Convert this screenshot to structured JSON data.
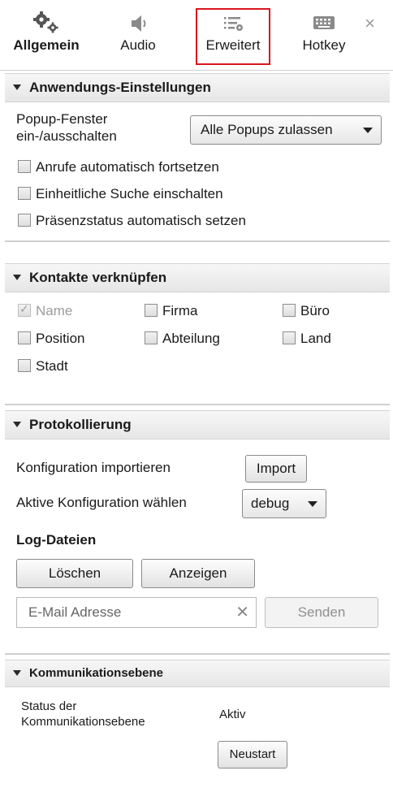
{
  "tabs": [
    {
      "label": "Allgemein",
      "icon": "gears-icon"
    },
    {
      "label": "Audio",
      "icon": "speaker-icon"
    },
    {
      "label": "Erweitert",
      "icon": "advanced-settings-icon"
    },
    {
      "label": "Hotkey",
      "icon": "keyboard-icon"
    }
  ],
  "close_glyph": "×",
  "app_settings": {
    "title": "Anwendungs-Einstellungen",
    "popup_label_line1": "Popup-Fenster",
    "popup_label_line2": "ein-/ausschalten",
    "popup_value": "Alle Popups zulassen",
    "checkboxes": [
      {
        "label": "Anrufe automatisch fortsetzen",
        "checked": false
      },
      {
        "label": "Einheitliche Suche einschalten",
        "checked": false
      },
      {
        "label": "Präsenzstatus automatisch setzen",
        "checked": false
      }
    ]
  },
  "contacts": {
    "title": "Kontakte verknüpfen",
    "fields": [
      {
        "label": "Name",
        "checked": true,
        "disabled": true
      },
      {
        "label": "Firma",
        "checked": false
      },
      {
        "label": "Büro",
        "checked": false
      },
      {
        "label": "Position",
        "checked": false
      },
      {
        "label": "Abteilung",
        "checked": false
      },
      {
        "label": "Land",
        "checked": false
      },
      {
        "label": "Stadt",
        "checked": false
      }
    ]
  },
  "logging": {
    "title": "Protokollierung",
    "import_label": "Konfiguration importieren",
    "import_button": "Import",
    "active_label": "Aktive Konfiguration wählen",
    "active_value": "debug",
    "logfiles_heading": "Log-Dateien",
    "delete_button": "Löschen",
    "show_button": "Anzeigen",
    "email_placeholder": "E-Mail Adresse",
    "clear_glyph": "✕",
    "send_button": "Senden"
  },
  "comm_layer": {
    "title": "Kommunikationsebene",
    "status_label_line1": "Status der",
    "status_label_line2": "Kommunikationsebene",
    "status_value": "Aktiv",
    "restart_button": "Neustart"
  },
  "colors": {
    "active_tab_border": "#d9171d"
  }
}
